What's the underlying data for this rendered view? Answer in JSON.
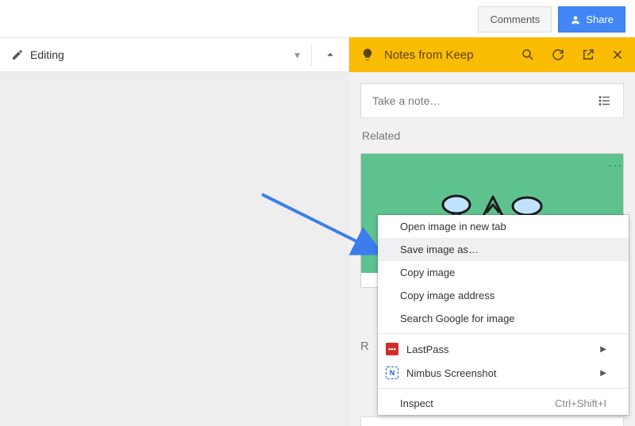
{
  "topbar": {
    "comments": "Comments",
    "share": "Share"
  },
  "toolbar": {
    "mode": "Editing"
  },
  "keep": {
    "title": "Notes from Keep",
    "note_placeholder": "Take a note…",
    "related_label": "Related",
    "related_below": "R"
  },
  "context_menu": {
    "items": [
      {
        "label": "Open image in new tab"
      },
      {
        "label": "Save image as…",
        "hover": true
      },
      {
        "label": "Copy image"
      },
      {
        "label": "Copy image address"
      },
      {
        "label": "Search Google for image"
      }
    ],
    "extensions": [
      {
        "label": "LastPass",
        "icon_bg": "#d32d27",
        "icon_text": "•••",
        "icon_color": "#fff"
      },
      {
        "label": "Nimbus Screenshot",
        "icon_bg": "#fff",
        "icon_text": "N",
        "icon_color": "#1a5fd6",
        "border": "1px dashed #1a5fd6"
      }
    ],
    "inspect": {
      "label": "Inspect",
      "shortcut": "Ctrl+Shift+I"
    }
  }
}
